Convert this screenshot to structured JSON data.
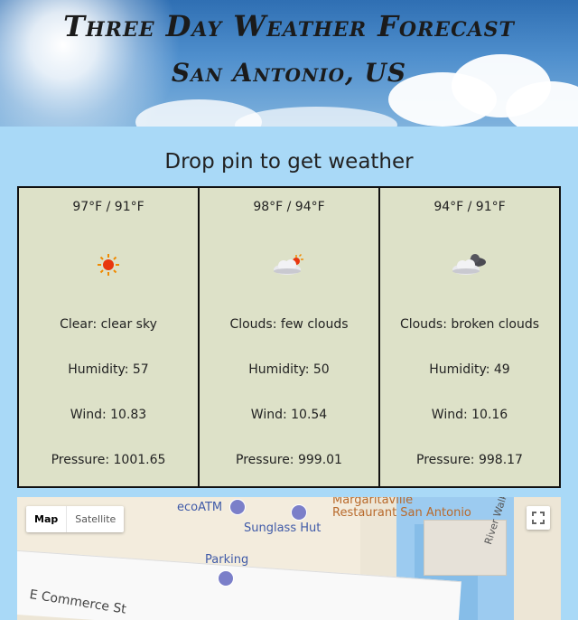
{
  "header": {
    "title": "Three Day Weather Forecast",
    "location": "San Antonio, US"
  },
  "prompt": "Drop pin to get weather",
  "days": [
    {
      "temps": "97°F / 91°F",
      "icon": "sun-icon",
      "description": "Clear: clear sky",
      "humidity": "Humidity: 57",
      "wind": "Wind: 10.83",
      "pressure": "Pressure: 1001.65"
    },
    {
      "temps": "98°F / 94°F",
      "icon": "few-clouds-icon",
      "description": "Clouds: few clouds",
      "humidity": "Humidity: 50",
      "wind": "Wind: 10.54",
      "pressure": "Pressure: 999.01"
    },
    {
      "temps": "94°F / 91°F",
      "icon": "broken-clouds-icon",
      "description": "Clouds: broken clouds",
      "humidity": "Humidity: 49",
      "wind": "Wind: 10.16",
      "pressure": "Pressure: 998.17"
    }
  ],
  "map": {
    "type_map": "Map",
    "type_satellite": "Satellite",
    "pois": {
      "ecoatm": "ecoATM",
      "sunglass": "Sunglass Hut",
      "margaritaville_1": "Margaritaville",
      "margaritaville_2": "Restaurant San Antonio",
      "parking": "Parking",
      "street": "E Commerce St",
      "river_walk": "River Walk"
    }
  },
  "colors": {
    "page_bg": "#a9d9f7",
    "card_bg": "#dde1c8",
    "card_border": "#111111"
  }
}
